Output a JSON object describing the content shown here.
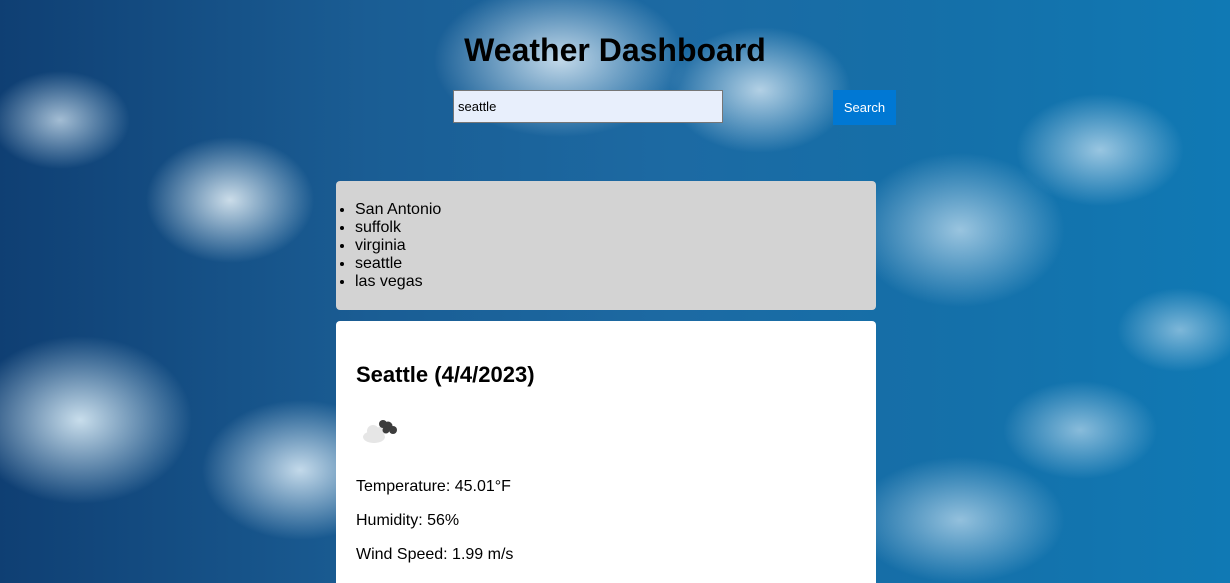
{
  "header": {
    "title": "Weather Dashboard"
  },
  "search": {
    "value": "seattle",
    "button_label": "Search"
  },
  "history": {
    "items": [
      "San Antonio",
      "suffolk",
      "virginia",
      "seattle",
      "las vegas"
    ]
  },
  "current": {
    "heading": "Seattle (4/4/2023)",
    "icon": "broken-clouds-icon",
    "temperature": "Temperature: 45.01°F",
    "humidity": "Humidity: 56%",
    "wind": "Wind Speed: 1.99 m/s"
  },
  "colors": {
    "search_button": "#0078d4",
    "history_panel": "#d3d3d3",
    "input_bg": "#e8effc"
  }
}
